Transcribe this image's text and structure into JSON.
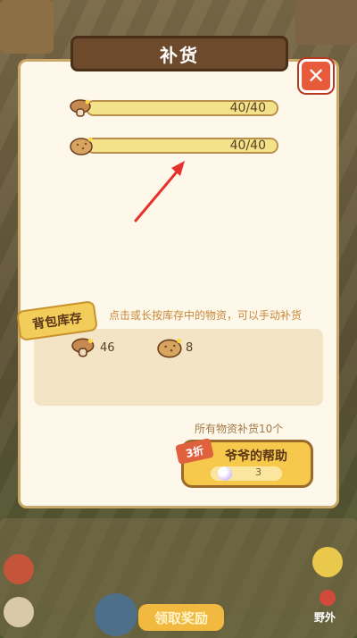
{
  "dialog": {
    "title": "补货",
    "close_label": "✕"
  },
  "stock_bars": [
    {
      "item": "mushroom-icon",
      "text": "40/40",
      "fill": 1.0
    },
    {
      "item": "potato-icon",
      "text": "40/40",
      "fill": 1.0
    }
  ],
  "hint": "点击或长按库存中的物资，可以手动补货",
  "backpack": {
    "tag": "背包库存",
    "items": [
      {
        "item": "mushroom-icon",
        "count": "46"
      },
      {
        "item": "potato-icon",
        "count": "8"
      }
    ]
  },
  "restock_all_text": "所有物资补货10个",
  "help_button": {
    "label": "爷爷的帮助",
    "cost": "3",
    "discount": "3折"
  },
  "hud": {
    "reward_label": "领取奖励",
    "outdoor_label": "野外"
  },
  "colors": {
    "panel": "#fdf8ea",
    "title_banner": "#6d4a2c",
    "close": "#e85b3a",
    "bar_fill": "#f3e28a",
    "accent_text": "#c9883b",
    "button": "#f6c84b",
    "arrow": "#e5322d"
  }
}
